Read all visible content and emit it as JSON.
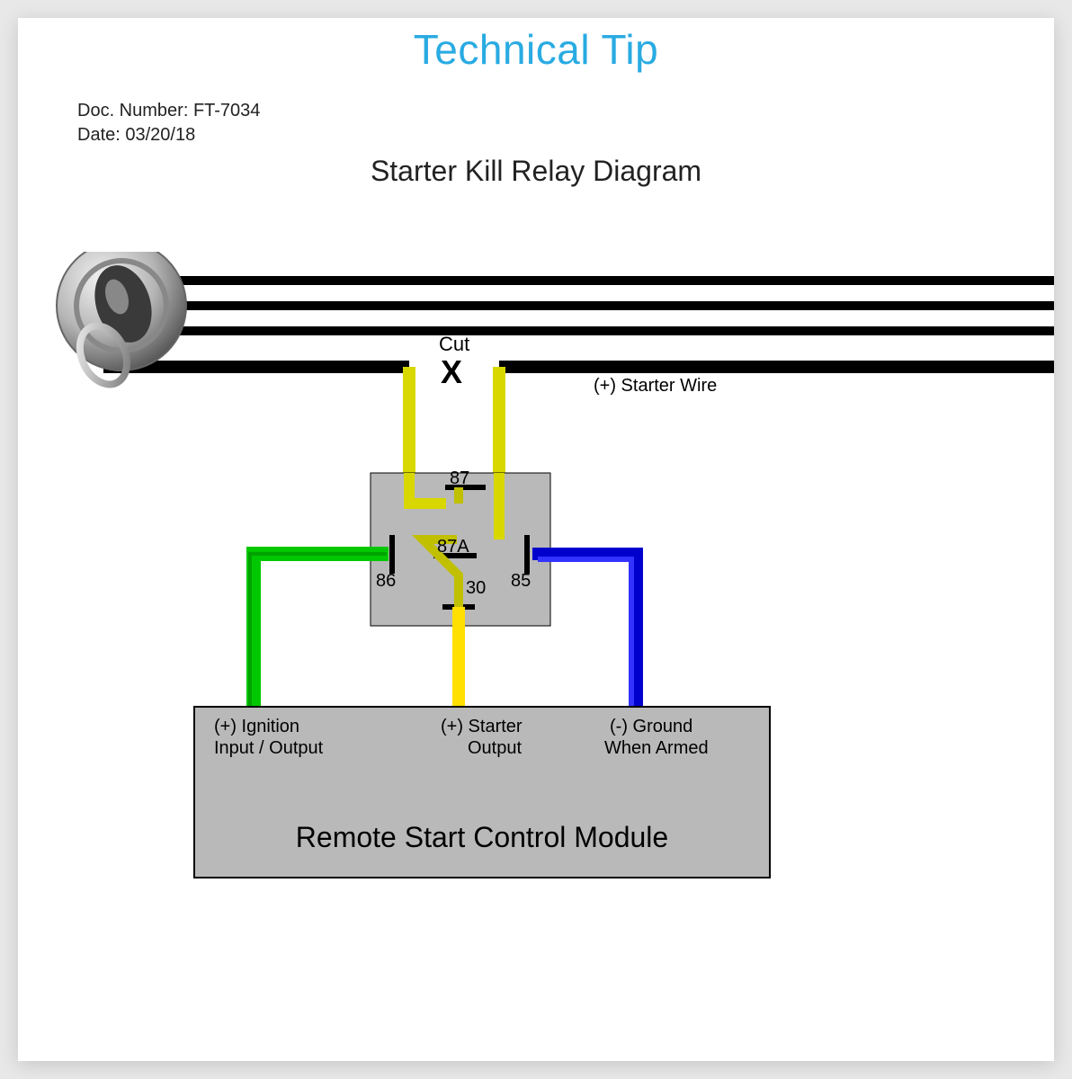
{
  "header": {
    "title": "Technical Tip",
    "doc_number_label": "Doc. Number:",
    "doc_number": "FT-7034",
    "date_label": "Date:",
    "date": "03/20/18"
  },
  "diagram": {
    "title": "Starter Kill Relay Diagram",
    "cut_label": "Cut",
    "x_mark": "X",
    "starter_wire_label": "(+) Starter Wire",
    "relay_pins": {
      "p87": "87",
      "p87a": "87A",
      "p30": "30",
      "p86": "86",
      "p85": "85"
    },
    "module": {
      "title": "Remote Start Control Module",
      "ignition_label_1": "(+) Ignition",
      "ignition_label_2": "Input / Output",
      "starter_label_1": "(+) Starter",
      "starter_label_2": "Output",
      "ground_label_1": "(-) Ground",
      "ground_label_2": "When Armed"
    },
    "colors": {
      "green": "#00c800",
      "yellow_bright": "#ffe600",
      "yellow_olive": "#c0c000",
      "blue": "#0000cc",
      "grey": "#b9b9b9",
      "black": "#000000"
    }
  }
}
